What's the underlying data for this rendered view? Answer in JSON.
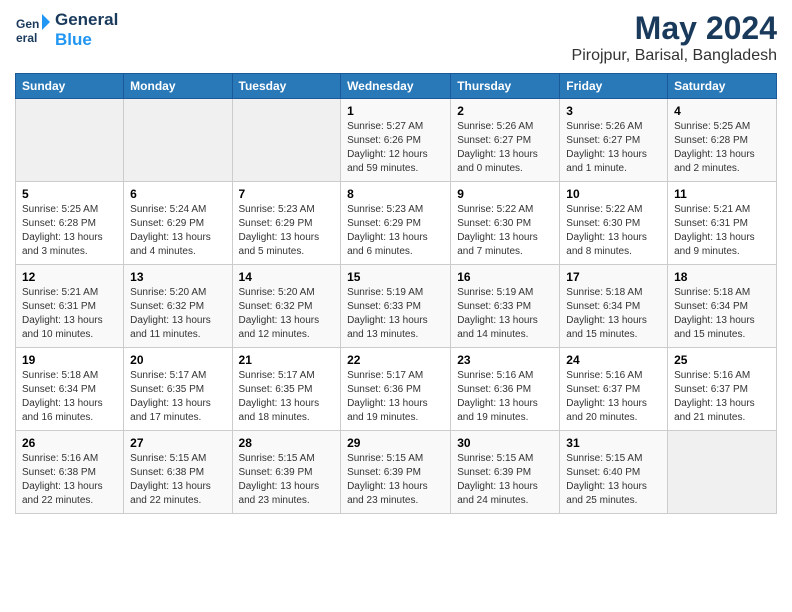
{
  "header": {
    "logo_line1": "General",
    "logo_line2": "Blue",
    "month_title": "May 2024",
    "location": "Pirojpur, Barisal, Bangladesh"
  },
  "weekdays": [
    "Sunday",
    "Monday",
    "Tuesday",
    "Wednesday",
    "Thursday",
    "Friday",
    "Saturday"
  ],
  "weeks": [
    [
      {
        "day": "",
        "info": ""
      },
      {
        "day": "",
        "info": ""
      },
      {
        "day": "",
        "info": ""
      },
      {
        "day": "1",
        "info": "Sunrise: 5:27 AM\nSunset: 6:26 PM\nDaylight: 12 hours\nand 59 minutes."
      },
      {
        "day": "2",
        "info": "Sunrise: 5:26 AM\nSunset: 6:27 PM\nDaylight: 13 hours\nand 0 minutes."
      },
      {
        "day": "3",
        "info": "Sunrise: 5:26 AM\nSunset: 6:27 PM\nDaylight: 13 hours\nand 1 minute."
      },
      {
        "day": "4",
        "info": "Sunrise: 5:25 AM\nSunset: 6:28 PM\nDaylight: 13 hours\nand 2 minutes."
      }
    ],
    [
      {
        "day": "5",
        "info": "Sunrise: 5:25 AM\nSunset: 6:28 PM\nDaylight: 13 hours\nand 3 minutes."
      },
      {
        "day": "6",
        "info": "Sunrise: 5:24 AM\nSunset: 6:29 PM\nDaylight: 13 hours\nand 4 minutes."
      },
      {
        "day": "7",
        "info": "Sunrise: 5:23 AM\nSunset: 6:29 PM\nDaylight: 13 hours\nand 5 minutes."
      },
      {
        "day": "8",
        "info": "Sunrise: 5:23 AM\nSunset: 6:29 PM\nDaylight: 13 hours\nand 6 minutes."
      },
      {
        "day": "9",
        "info": "Sunrise: 5:22 AM\nSunset: 6:30 PM\nDaylight: 13 hours\nand 7 minutes."
      },
      {
        "day": "10",
        "info": "Sunrise: 5:22 AM\nSunset: 6:30 PM\nDaylight: 13 hours\nand 8 minutes."
      },
      {
        "day": "11",
        "info": "Sunrise: 5:21 AM\nSunset: 6:31 PM\nDaylight: 13 hours\nand 9 minutes."
      }
    ],
    [
      {
        "day": "12",
        "info": "Sunrise: 5:21 AM\nSunset: 6:31 PM\nDaylight: 13 hours\nand 10 minutes."
      },
      {
        "day": "13",
        "info": "Sunrise: 5:20 AM\nSunset: 6:32 PM\nDaylight: 13 hours\nand 11 minutes."
      },
      {
        "day": "14",
        "info": "Sunrise: 5:20 AM\nSunset: 6:32 PM\nDaylight: 13 hours\nand 12 minutes."
      },
      {
        "day": "15",
        "info": "Sunrise: 5:19 AM\nSunset: 6:33 PM\nDaylight: 13 hours\nand 13 minutes."
      },
      {
        "day": "16",
        "info": "Sunrise: 5:19 AM\nSunset: 6:33 PM\nDaylight: 13 hours\nand 14 minutes."
      },
      {
        "day": "17",
        "info": "Sunrise: 5:18 AM\nSunset: 6:34 PM\nDaylight: 13 hours\nand 15 minutes."
      },
      {
        "day": "18",
        "info": "Sunrise: 5:18 AM\nSunset: 6:34 PM\nDaylight: 13 hours\nand 15 minutes."
      }
    ],
    [
      {
        "day": "19",
        "info": "Sunrise: 5:18 AM\nSunset: 6:34 PM\nDaylight: 13 hours\nand 16 minutes."
      },
      {
        "day": "20",
        "info": "Sunrise: 5:17 AM\nSunset: 6:35 PM\nDaylight: 13 hours\nand 17 minutes."
      },
      {
        "day": "21",
        "info": "Sunrise: 5:17 AM\nSunset: 6:35 PM\nDaylight: 13 hours\nand 18 minutes."
      },
      {
        "day": "22",
        "info": "Sunrise: 5:17 AM\nSunset: 6:36 PM\nDaylight: 13 hours\nand 19 minutes."
      },
      {
        "day": "23",
        "info": "Sunrise: 5:16 AM\nSunset: 6:36 PM\nDaylight: 13 hours\nand 19 minutes."
      },
      {
        "day": "24",
        "info": "Sunrise: 5:16 AM\nSunset: 6:37 PM\nDaylight: 13 hours\nand 20 minutes."
      },
      {
        "day": "25",
        "info": "Sunrise: 5:16 AM\nSunset: 6:37 PM\nDaylight: 13 hours\nand 21 minutes."
      }
    ],
    [
      {
        "day": "26",
        "info": "Sunrise: 5:16 AM\nSunset: 6:38 PM\nDaylight: 13 hours\nand 22 minutes."
      },
      {
        "day": "27",
        "info": "Sunrise: 5:15 AM\nSunset: 6:38 PM\nDaylight: 13 hours\nand 22 minutes."
      },
      {
        "day": "28",
        "info": "Sunrise: 5:15 AM\nSunset: 6:39 PM\nDaylight: 13 hours\nand 23 minutes."
      },
      {
        "day": "29",
        "info": "Sunrise: 5:15 AM\nSunset: 6:39 PM\nDaylight: 13 hours\nand 23 minutes."
      },
      {
        "day": "30",
        "info": "Sunrise: 5:15 AM\nSunset: 6:39 PM\nDaylight: 13 hours\nand 24 minutes."
      },
      {
        "day": "31",
        "info": "Sunrise: 5:15 AM\nSunset: 6:40 PM\nDaylight: 13 hours\nand 25 minutes."
      },
      {
        "day": "",
        "info": ""
      }
    ]
  ]
}
